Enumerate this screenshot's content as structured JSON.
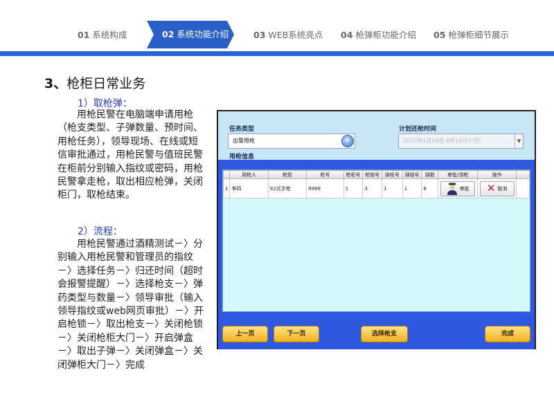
{
  "nav": {
    "items": [
      {
        "num": "01",
        "label": "系统构成"
      },
      {
        "num": "02",
        "label": "系统功能介绍"
      },
      {
        "num": "03",
        "label": "WEB系统亮点"
      },
      {
        "num": "04",
        "label": "枪弹柜功能介绍"
      },
      {
        "num": "05",
        "label": "枪弹柜细节展示"
      }
    ],
    "accent_color": "#2463d8"
  },
  "section": {
    "number": "3、",
    "title": "枪柜日常业务"
  },
  "content": {
    "part1_heading": "1）取枪弹：",
    "part1_text": "用枪民警在电脑端申请用枪（枪支类型、子弹数量、预时间、用枪任务），领导现场、在线或短信审批通过，用枪民警与值班民警在柜前分别输入指纹或密码，用枪民警拿走枪，取出相应枪弹，关闭柜门，取枪结束。",
    "part2_heading": "2）流程：",
    "part2_text": "用枪民警通过酒精测试－〉分别输入用枪民警和管理员的指纹－〉选择任务－〉归还时间（超时会报警提醒）－〉选择枪支－〉弹药类型与数量－〉领导审批（输入领导指纹或web网页审批）－〉开启枪锁－〉取出枪支－〉关闭枪锁－〉关闭枪柜大门－〉开启弹盒－〉取出子弹－〉关闭弹盒－〉关闭弹柜大门－〉完成"
  },
  "app": {
    "task_type_label": "任务类型",
    "task_type_value": "出警用枪",
    "return_time_label": "计划还枪时间",
    "return_time_value": "2010年1月04日 6时16分47秒",
    "gun_info_label": "用枪信息",
    "columns": [
      "",
      "用枪人",
      "枪型",
      "枪号",
      "枪柜号",
      "枪锁号",
      "弹柜号",
      "弹锁号",
      "弹数",
      "审批/领枪",
      "操作"
    ],
    "rows": [
      {
        "idx": "1",
        "user": "李四",
        "gun_type": "92式手枪",
        "gun_no": "9999",
        "cabinet": "1",
        "gun_lock": "3",
        "ammo_cabinet": "1",
        "ammo_lock": "1",
        "ammo_count": "6",
        "approve_label": "审批",
        "cancel_label": "取消"
      }
    ],
    "buttons": {
      "prev": "上一页",
      "next": "下一页",
      "select_gun": "选择枪支",
      "done": "完成"
    }
  }
}
